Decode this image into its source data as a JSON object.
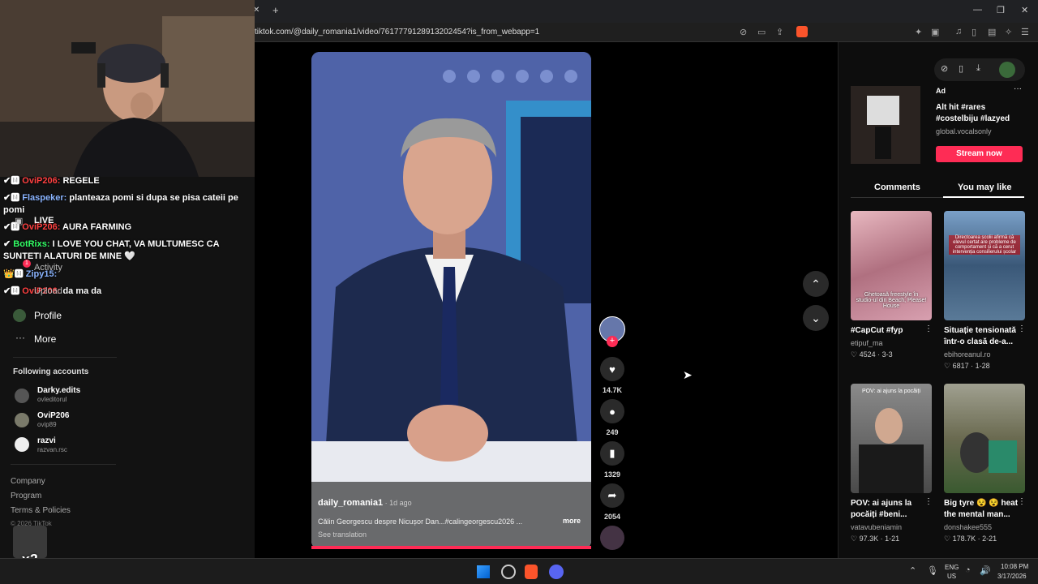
{
  "browser": {
    "url": "tiktok.com/@daily_romania1/video/7617779128913202454?is_from_webapp=1",
    "new_tab": "+",
    "tab_close": "✕"
  },
  "chat": [
    {
      "user": "OviP206:",
      "text": "REGELE",
      "color": "#ff4040"
    },
    {
      "user": "Flaspeker:",
      "text": "planteaza pomi si dupa se pisa cateii pe pomi",
      "color": "#8ab4ff"
    },
    {
      "user": "OviP206:",
      "text": "AURA FARMING",
      "color": "#ff4040"
    },
    {
      "user": "BotRixs:",
      "text": "I LOVE YOU CHAT, VA MULTUMESC CA SUNTETI ALATURI DE MINE 🤍",
      "color": "#33ff66"
    },
    {
      "user": "Zipy15:",
      "text": "",
      "color": "#8ab4ff"
    },
    {
      "user": "OviP206:",
      "text": "da ma da",
      "color": "#ff4040"
    }
  ],
  "sidebar": {
    "live": "LIVE",
    "activity": "Activity",
    "activity_badge": "1",
    "upload": "Upload",
    "profile": "Profile",
    "more": "More",
    "following_title": "Following accounts",
    "following": [
      {
        "name": "Darky.edits",
        "handle": "ovleditorul"
      },
      {
        "name": "OviP206",
        "handle": "ovip89"
      },
      {
        "name": "razvi",
        "handle": "razvan.rsc"
      }
    ],
    "footer": [
      "Company",
      "Program",
      "Terms & Policies"
    ],
    "copyright": "© 2026 TikTok",
    "overlay_badge": "x2"
  },
  "video": {
    "author": "daily_romania1",
    "time": " · 1d ago",
    "caption": "Călin Georgescu despre Nicușor Dan...#calingeorgescu2026 ...",
    "more": "more",
    "see_translation": "See translation"
  },
  "actions": {
    "likes": "14.7K",
    "comments": "249",
    "saves": "1329",
    "shares": "2054"
  },
  "ad": {
    "label": "Ad",
    "title": "Alt hit #rares #costelbiju #lazyed",
    "source": "global.vocalsonly",
    "cta": "Stream now"
  },
  "tabs": {
    "comments": "Comments",
    "you_may_like": "You may like"
  },
  "cards": [
    {
      "title": "#CapCut #fyp",
      "user": "etipuf_ma",
      "likes": "4524",
      "duration": "3-3",
      "thumb_text": "Ghetoasă freestyle în studio-ul din Beach, Please! House"
    },
    {
      "title": "Situație tensionată într-o clasă de-a...",
      "user": "ebihoreanul.ro",
      "likes": "6817",
      "duration": "1-28",
      "thumb_text": "Directoarea școlii afirmă că elevul certat are probleme de comportament și că a cerut intervenția consilierului școlar"
    },
    {
      "title": "POV: ai ajuns la pocăiți #beni...",
      "user": "vatavubeniamin",
      "likes": "97.3K",
      "duration": "1-21",
      "thumb_text": "POV: ai ajuns la pocăiți"
    },
    {
      "title": "Big tyre 😵 😵 heat the mental man...",
      "user": "donshakee555",
      "likes": "178.7K",
      "duration": "2-21",
      "thumb_text": ""
    }
  ],
  "taskbar": {
    "lang1": "ENG",
    "lang2": "US",
    "time": "10:08 PM",
    "date": "3/17/2026"
  }
}
